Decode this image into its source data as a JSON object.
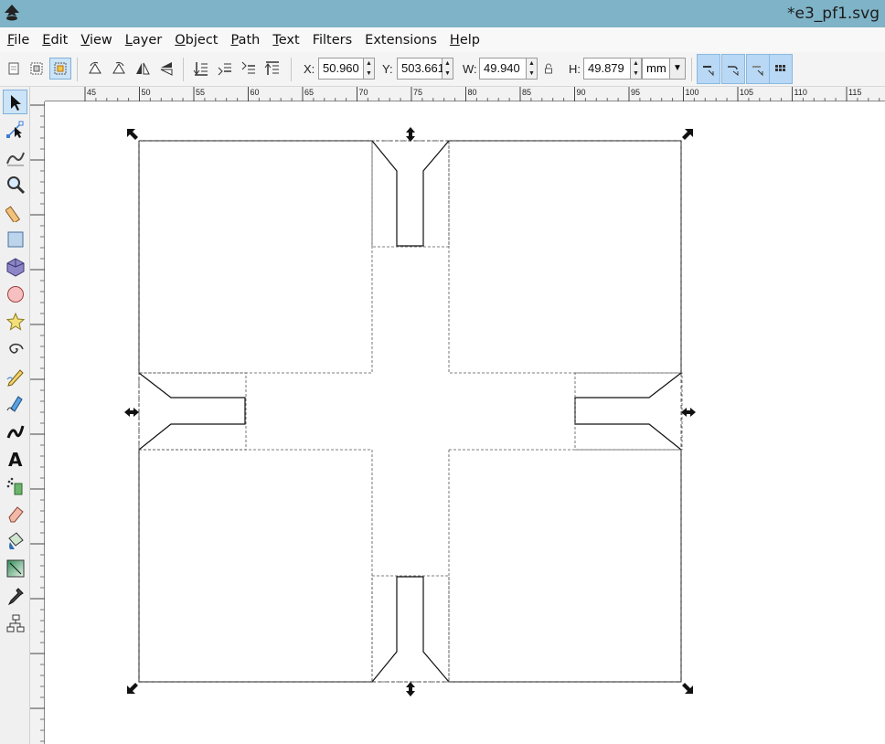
{
  "window": {
    "title": "*e3_pf1.svg"
  },
  "menu": [
    {
      "label": "File",
      "ul": "F",
      "rest": "ile"
    },
    {
      "label": "Edit",
      "ul": "E",
      "rest": "dit"
    },
    {
      "label": "View",
      "ul": "V",
      "rest": "iew"
    },
    {
      "label": "Layer",
      "ul": "L",
      "rest": "ayer"
    },
    {
      "label": "Object",
      "ul": "O",
      "rest": "bject"
    },
    {
      "label": "Path",
      "ul": "P",
      "rest": "ath"
    },
    {
      "label": "Text",
      "ul": "T",
      "rest": "ext"
    },
    {
      "label": "Filters",
      "ul": "",
      "rest": "Filters"
    },
    {
      "label": "Extensions",
      "ul": "",
      "rest": "Extensions"
    },
    {
      "label": "Help",
      "ul": "H",
      "rest": "elp"
    }
  ],
  "toolbar": {
    "x_label": "X:",
    "x_value": "50.960",
    "y_label": "Y:",
    "y_value": "503.661",
    "w_label": "W:",
    "w_value": "49.940",
    "h_label": "H:",
    "h_value": "49.879",
    "unit": "mm"
  },
  "ruler": {
    "top_labels": [
      "45",
      "50",
      "55",
      "60",
      "65",
      "70",
      "75",
      "80",
      "85",
      "90",
      "95",
      "100",
      "105",
      "110",
      "115"
    ]
  },
  "tools": [
    "selector-tool-icon",
    "node-tool-icon",
    "tweak-tool-icon",
    "zoom-tool-icon",
    "measure-tool-icon",
    "rectangle-tool-icon",
    "box3d-tool-icon",
    "ellipse-tool-icon",
    "star-tool-icon",
    "spiral-tool-icon",
    "pencil-tool-icon",
    "pen-tool-icon",
    "calligraphy-tool-icon",
    "text-tool-icon",
    "spray-tool-icon",
    "eraser-tool-icon",
    "paint-bucket-tool-icon",
    "gradient-tool-icon",
    "dropper-tool-icon",
    "connector-tool-icon"
  ],
  "colors": {
    "titlebar": "#7fb3c7",
    "active_tool": "#cce4f7",
    "snap_bar": "#b8d8f5"
  }
}
